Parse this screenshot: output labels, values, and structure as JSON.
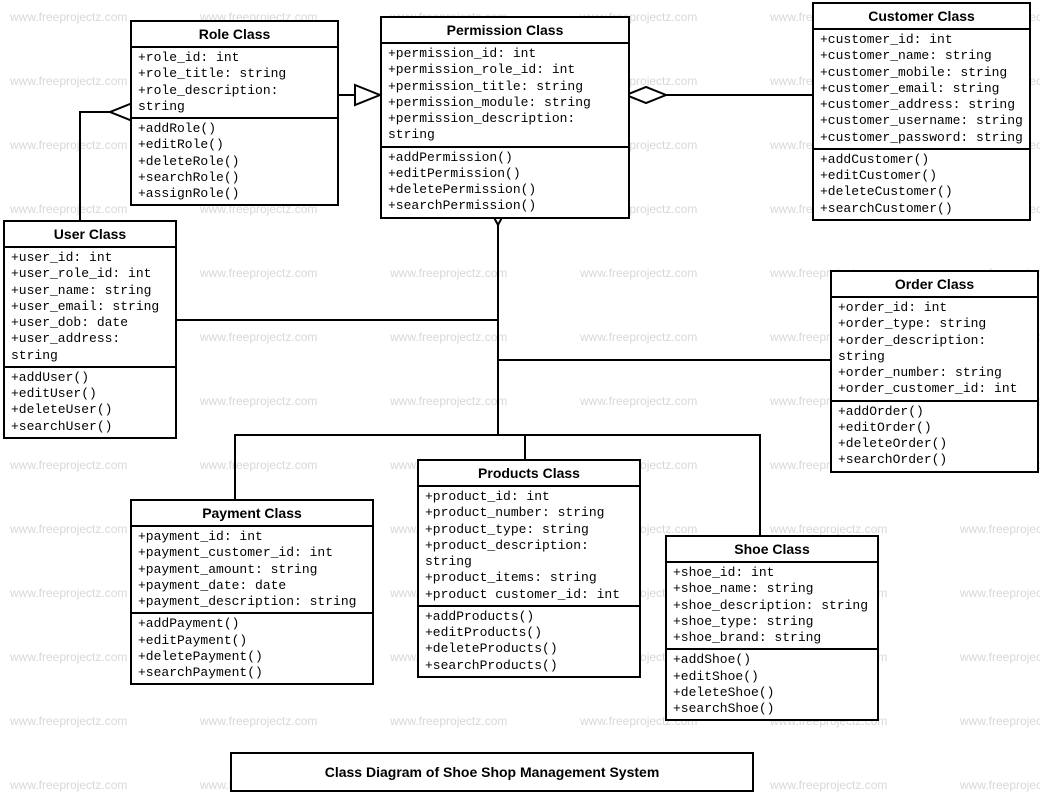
{
  "watermark_text": "www.freeprojectz.com",
  "caption": "Class Diagram of Shoe Shop Management System",
  "classes": {
    "role": {
      "title": "Role Class",
      "attrs": [
        "+role_id: int",
        "+role_title: string",
        "+role_description: string"
      ],
      "ops": [
        "+addRole()",
        "+editRole()",
        "+deleteRole()",
        "+searchRole()",
        "+assignRole()"
      ]
    },
    "permission": {
      "title": "Permission Class",
      "attrs": [
        "+permission_id: int",
        "+permission_role_id: int",
        "+permission_title: string",
        "+permission_module: string",
        "+permission_description: string"
      ],
      "ops": [
        "+addPermission()",
        "+editPermission()",
        "+deletePermission()",
        "+searchPermission()"
      ]
    },
    "customer": {
      "title": "Customer Class",
      "attrs": [
        "+customer_id: int",
        "+customer_name: string",
        "+customer_mobile: string",
        "+customer_email: string",
        "+customer_address: string",
        "+customer_username: string",
        "+customer_password: string"
      ],
      "ops": [
        "+addCustomer()",
        "+editCustomer()",
        "+deleteCustomer()",
        "+searchCustomer()"
      ]
    },
    "user": {
      "title": "User Class",
      "attrs": [
        "+user_id: int",
        "+user_role_id: int",
        "+user_name: string",
        "+user_email: string",
        "+user_dob: date",
        "+user_address: string"
      ],
      "ops": [
        "+addUser()",
        "+editUser()",
        "+deleteUser()",
        "+searchUser()"
      ]
    },
    "order": {
      "title": "Order Class",
      "attrs": [
        "+order_id: int",
        "+order_type: string",
        "+order_description: string",
        "+order_number: string",
        "+order_customer_id: int"
      ],
      "ops": [
        "+addOrder()",
        "+editOrder()",
        "+deleteOrder()",
        "+searchOrder()"
      ]
    },
    "payment": {
      "title": "Payment Class",
      "attrs": [
        "+payment_id: int",
        "+payment_customer_id: int",
        "+payment_amount: string",
        "+payment_date: date",
        "+payment_description: string"
      ],
      "ops": [
        "+addPayment()",
        "+editPayment()",
        "+deletePayment()",
        "+searchPayment()"
      ]
    },
    "products": {
      "title": "Products  Class",
      "attrs": [
        "+product_id: int",
        "+product_number: string",
        "+product_type: string",
        "+product_description: string",
        "+product_items: string",
        "+product customer_id: int"
      ],
      "ops": [
        "+addProducts()",
        "+editProducts()",
        "+deleteProducts()",
        "+searchProducts()"
      ]
    },
    "shoe": {
      "title": "Shoe Class",
      "attrs": [
        "+shoe_id: int",
        "+shoe_name: string",
        "+shoe_description: string",
        "+shoe_type: string",
        "+shoe_brand: string"
      ],
      "ops": [
        "+addShoe()",
        "+editShoe()",
        "+deleteShoe()",
        "+searchShoe()"
      ]
    }
  }
}
